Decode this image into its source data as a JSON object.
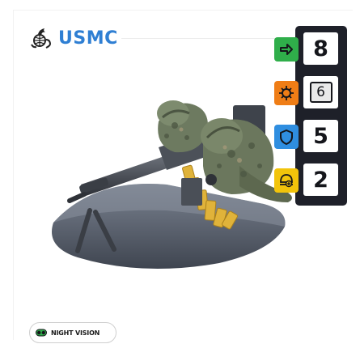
{
  "faction": {
    "name": "USMC",
    "icon": "eagle-globe-anchor-icon",
    "color": "#2f7fd3"
  },
  "miniature": {
    "icon": "machine-gun-team-miniature"
  },
  "stats": [
    {
      "key": "move",
      "icon": "arrow-right-icon",
      "color": "#2fae4a",
      "value": "8",
      "framed": false
    },
    {
      "key": "skill",
      "icon": "burst-target-icon",
      "color": "#ef7d16",
      "value": "6",
      "framed": true
    },
    {
      "key": "armor",
      "icon": "shield-icon",
      "color": "#2f8ee0",
      "value": "5",
      "framed": false
    },
    {
      "key": "wounds",
      "icon": "helmet-cross-icon",
      "color": "#f2c40b",
      "value": "2",
      "framed": false
    }
  ],
  "traits": [
    {
      "label": "NIGHT VISION",
      "icon": "goggles-icon",
      "color": "#2fae4a"
    }
  ]
}
